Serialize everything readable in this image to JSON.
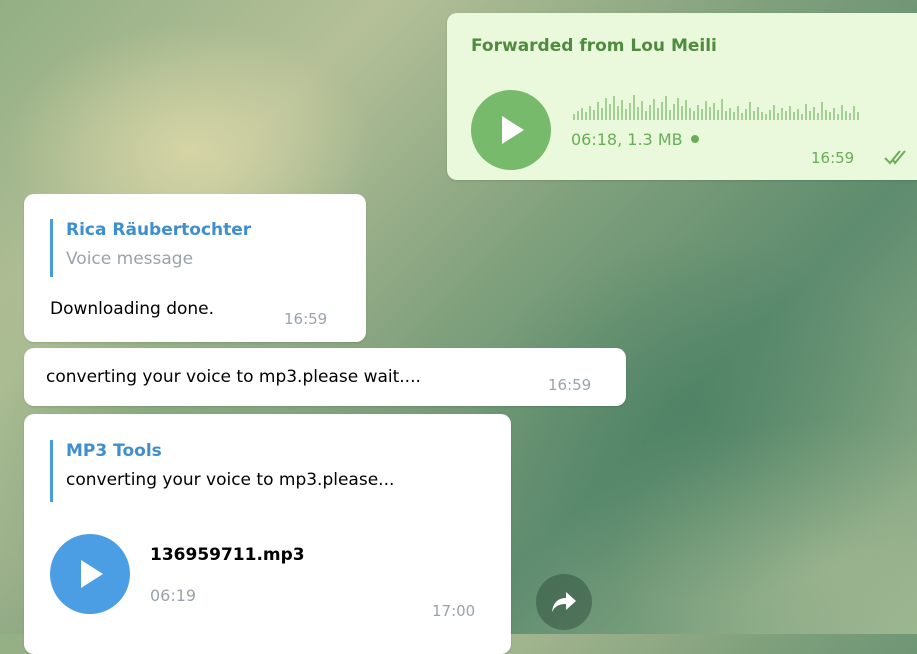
{
  "forwarded": {
    "header": "Forwarded from Lou Meili",
    "meta": "06:18, 1.3 MB",
    "time": "16:59",
    "play_icon": "play-icon",
    "check_icon": "double-check-icon",
    "color": "#78ba6b"
  },
  "rica": {
    "reply_author": "Rica Räubertochter",
    "reply_text": "Voice message",
    "body": "Downloading done.",
    "time": "16:59"
  },
  "converting": {
    "body": "converting your voice to mp3.please wait....",
    "time": "16:59"
  },
  "mp3": {
    "reply_author": "MP3 Tools",
    "reply_text": "converting your voice to mp3.please...",
    "file_name": "136959711.mp3",
    "duration": "06:19",
    "time": "17:00",
    "play_icon": "play-icon",
    "color": "#4b9ee3"
  },
  "share_icon": "share-arrow-icon"
}
